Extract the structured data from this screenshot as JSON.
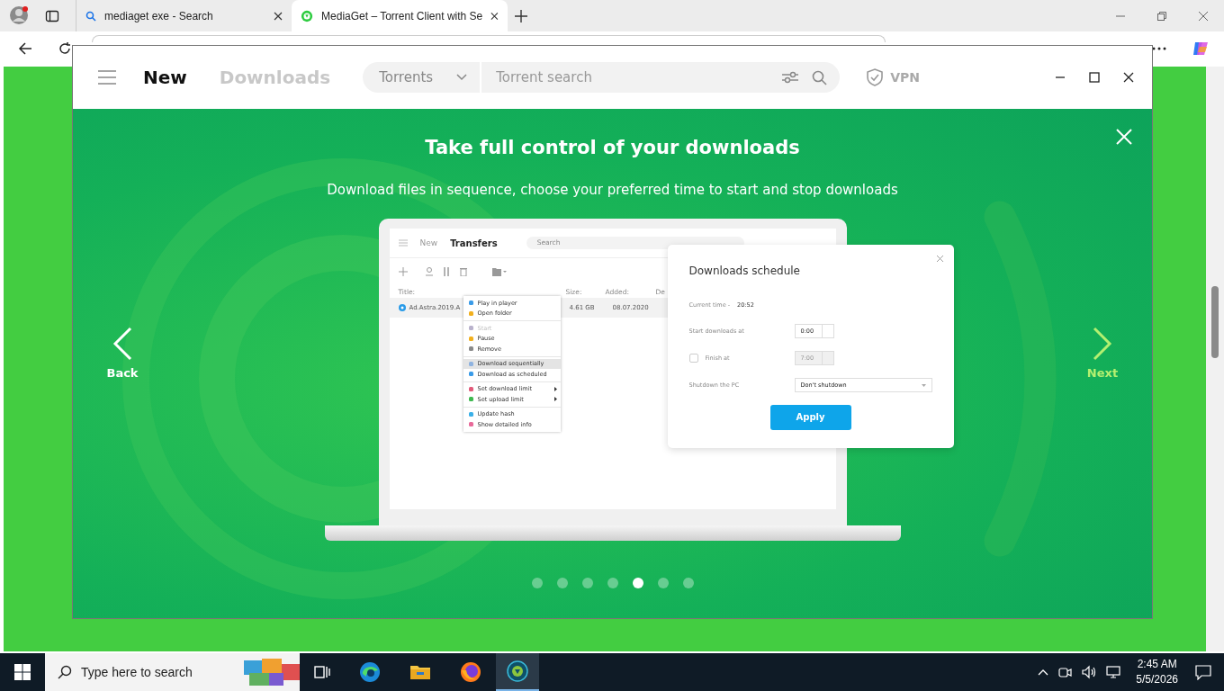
{
  "browser": {
    "tabs": [
      {
        "title": "mediaget exe - Search",
        "selected": false,
        "kind": "search"
      },
      {
        "title": "MediaGet – Torrent Client with Se",
        "selected": true,
        "kind": "site"
      }
    ]
  },
  "app": {
    "nav": [
      {
        "label": "New",
        "selected": true
      },
      {
        "label": "Downloads",
        "selected": false
      }
    ],
    "search": {
      "scope": "Torrents",
      "placeholder": "Torrent search"
    },
    "vpn": "VPN"
  },
  "slide": {
    "title": "Take full control of your downloads",
    "subtitle": "Download files in sequence, choose your preferred time to start and stop downloads",
    "back": "Back",
    "next": "Next",
    "dots": [
      {
        "selected": false
      },
      {
        "selected": false
      },
      {
        "selected": false
      },
      {
        "selected": false
      },
      {
        "selected": true
      },
      {
        "selected": false
      },
      {
        "selected": false
      }
    ]
  },
  "mockup": {
    "nav": [
      {
        "label": "New",
        "selected": false
      },
      {
        "label": "Transfers",
        "selected": true
      }
    ],
    "search_placeholder": "Search",
    "columns": [
      "Title:",
      "Size:",
      "Added:",
      "De"
    ],
    "row": {
      "name": "Ad.Astra.2019.A",
      "size": "4.61 GB",
      "added": "08.07.2020"
    },
    "menu_groups": [
      [
        {
          "label": "Play in player",
          "color": "#3a9be8",
          "disabled": false,
          "selected": false,
          "submenu": false
        },
        {
          "label": "Open folder",
          "color": "#f2b01e",
          "disabled": false,
          "selected": false,
          "submenu": false
        }
      ],
      [
        {
          "label": "Start",
          "color": "#b9b2cc",
          "disabled": true,
          "selected": false,
          "submenu": false
        },
        {
          "label": "Pause",
          "color": "#f2b01e",
          "disabled": false,
          "selected": false,
          "submenu": false
        },
        {
          "label": "Remove",
          "color": "#8a8a8a",
          "disabled": false,
          "selected": false,
          "submenu": false
        }
      ],
      [
        {
          "label": "Download sequentially",
          "color": "#8fb3e0",
          "disabled": false,
          "selected": true,
          "submenu": false
        },
        {
          "label": "Download as scheduled",
          "color": "#3a9be8",
          "disabled": false,
          "selected": false,
          "submenu": false
        }
      ],
      [
        {
          "label": "Set download limit",
          "color": "#e25a7a",
          "disabled": false,
          "selected": false,
          "submenu": true
        },
        {
          "label": "Set upload limit",
          "color": "#3fb950",
          "disabled": false,
          "selected": false,
          "submenu": true
        }
      ],
      [
        {
          "label": "Update hash",
          "color": "#3ab0e8",
          "disabled": false,
          "selected": false,
          "submenu": false
        },
        {
          "label": "Show detailed info",
          "color": "#e86a9a",
          "disabled": false,
          "selected": false,
          "submenu": false
        }
      ]
    ]
  },
  "schedule": {
    "title": "Downloads schedule",
    "current_label": "Current time -",
    "current_time": "20:52",
    "start_label": "Start downloads at",
    "start_value": "0:00",
    "finish": {
      "label": "Finish at",
      "checked": false,
      "value": "7:00"
    },
    "shutdown_label": "Shutdown the PC",
    "shutdown_value": "Don't shutdown",
    "apply": "Apply"
  },
  "taskbar": {
    "search_placeholder": "Type here to search",
    "time": "2:45 AM",
    "date": "5/5/2026"
  }
}
